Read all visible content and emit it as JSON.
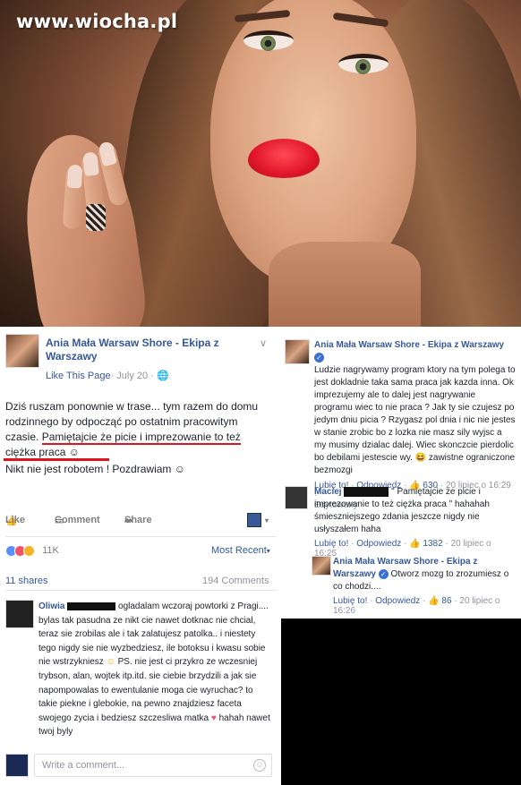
{
  "watermark": "www.wiocha.pl",
  "post": {
    "author": "Ania Mała Warsaw Shore - Ekipa z Warszawy",
    "like_page": "Like This Page",
    "date": "· July 20 · ",
    "globe_icon": "globe-icon",
    "text_a": "Dziś ruszam ponownie w trase... tym razem do domu rodzinnego by odpocząć po ostatnim pracowitym czasie.",
    "text_underlined": "Pamiętajcie że picie i imprezowanie to też ciężka praca",
    "text_b": "Nikt nie jest robotem ! Pozdrawiam",
    "emoji": "☺",
    "like_label": "Like",
    "comment_label": "Comment",
    "share_label": "Share",
    "reactions_count": "11K",
    "most_recent": "Most Recent",
    "shares": "11 shares",
    "comments": "194 Comments",
    "write_placeholder": "Write a comment...",
    "colors": {
      "link": "#365899",
      "underline": "#e0141c",
      "meta": "#90949c"
    }
  },
  "post_comment": {
    "name": "Oliwia",
    "text": "ogladalam wczoraj powtorki z Pragi.... bylas tak pasudna ze nikt cie nawet dotknac nie chcial, teraz sie zrobilas ale i tak zalatujesz patolka.. i niestety tego nigdy sie nie wyzbedziesz, ile botoksu i kwasu sobie nie wstrzykniesz",
    "text2": "PS. nie jest ci przykro ze wczesniej trybson, alan, wojtek itp.itd. sie ciebie brzydzili a jak sie napompowalas to ewentulanie moga cie wyruchac? to takie piekne i glebokie, na pewno znajdziesz faceta swojego zycia i bedziesz szczesliwa matka",
    "text3": "hahah nawet twoj byly",
    "heart": "♥",
    "smile": "☺"
  },
  "right_comments": [
    {
      "name": "Ania Mała Warsaw Shore - Ekipa z Warszawy",
      "text": "Ludzie nagrywamy program ktory na tym polega to jest dokladnie taka sama praca jak kazda inna. Ok imprezujemy ale to dalej jest nagrywanie programu wiec to nie praca ? Jak ty sie czujesz po jedym dniu picia ? Rzygasz pol dnia i nic nie jestes w stanie zrobic bo z lozka nie masz sily wyjsc a my musimy dzialac dalej. Wiec skonczcie pierdolic bo debilami jestescie wy.",
      "text_end": "zawistne ograniczone bezmozgi",
      "like": "Lubię to!",
      "reply": "Odpowiedz",
      "likes": "630",
      "date": "20 lipiec o 16:29",
      "edited": "Edytowany"
    },
    {
      "name": "Maciej",
      "text": "\" Pamiętajcie że picie i imprezowanie to też ciężka praca \" hahahah śmieszniejszego zdania jeszcze nigdy nie usłyszałem haha",
      "like": "Lubię to!",
      "reply": "Odpowiedz",
      "likes": "1382",
      "date": "20 lipiec o 16:25"
    },
    {
      "name": "Ania Mała Warsaw Shore - Ekipa z Warszawy",
      "text": "Otworz mozg to zrozumiesz o co chodzi....",
      "like": "Lubię to!",
      "reply": "Odpowiedz",
      "likes": "86",
      "date": "20 lipiec o 16:26"
    }
  ]
}
